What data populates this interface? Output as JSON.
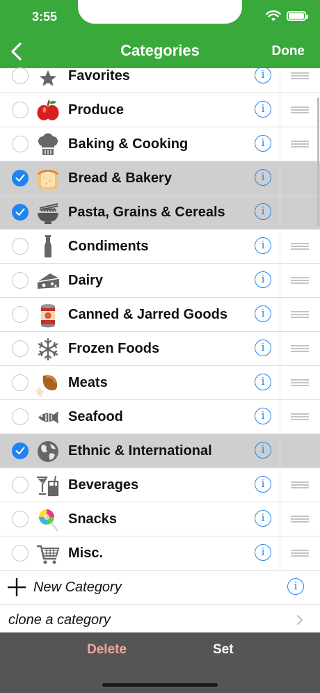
{
  "status": {
    "time": "3:55"
  },
  "nav": {
    "title": "Categories",
    "done_label": "Done"
  },
  "categories": [
    {
      "label": "Favorites",
      "icon": "star-icon",
      "selected": false
    },
    {
      "label": "Produce",
      "icon": "apple-icon",
      "selected": false
    },
    {
      "label": "Baking & Cooking",
      "icon": "chef-hat-icon",
      "selected": false
    },
    {
      "label": "Bread & Bakery",
      "icon": "bread-icon",
      "selected": true
    },
    {
      "label": "Pasta, Grains & Cereals",
      "icon": "noodle-bowl-icon",
      "selected": true
    },
    {
      "label": "Condiments",
      "icon": "bottle-icon",
      "selected": false
    },
    {
      "label": "Dairy",
      "icon": "cheese-icon",
      "selected": false
    },
    {
      "label": "Canned & Jarred Goods",
      "icon": "can-icon",
      "selected": false
    },
    {
      "label": "Frozen Foods",
      "icon": "snowflake-icon",
      "selected": false
    },
    {
      "label": "Meats",
      "icon": "drumstick-icon",
      "selected": false
    },
    {
      "label": "Seafood",
      "icon": "fish-icon",
      "selected": false
    },
    {
      "label": "Ethnic & International",
      "icon": "globe-icon",
      "selected": true
    },
    {
      "label": "Beverages",
      "icon": "drinks-icon",
      "selected": false
    },
    {
      "label": "Snacks",
      "icon": "lollipop-icon",
      "selected": false
    },
    {
      "label": "Misc.",
      "icon": "shopping-cart-icon",
      "selected": false
    }
  ],
  "new_category": {
    "label": "New Category"
  },
  "clone": {
    "label": "clone a category"
  },
  "bottom": {
    "delete_label": "Delete",
    "set_label": "Set"
  },
  "colors": {
    "header_green": "#3aa93c",
    "accent_blue": "#1e84ef",
    "selected_row": "#cfcfcf",
    "bottom_bar": "#555555",
    "delete_pink": "#f2a4a0"
  }
}
